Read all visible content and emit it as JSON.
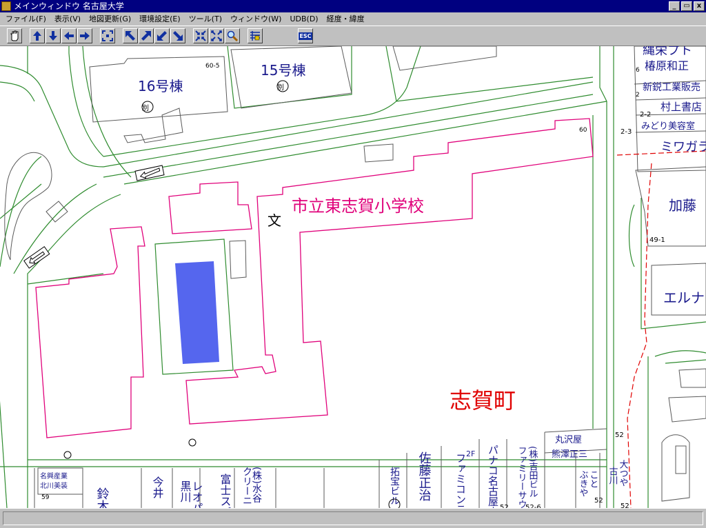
{
  "window": {
    "title": "メインウィンドウ 名古屋大学",
    "controls": [
      "_",
      "▭",
      "x"
    ]
  },
  "menu": [
    "ファイル(F)",
    "表示(V)",
    "地図更新(G)",
    "環境設定(E)",
    "ツール(T)",
    "ウィンドウ(W)",
    "UDB(D)",
    "経度・緯度"
  ],
  "toolbar": {
    "buttons": [
      {
        "name": "hand-tool",
        "icon": "hand-icon"
      },
      {
        "name": "pan-up",
        "icon": "arrow-up-icon"
      },
      {
        "name": "pan-down",
        "icon": "arrow-down-icon"
      },
      {
        "name": "pan-left",
        "icon": "arrow-left-icon"
      },
      {
        "name": "pan-right",
        "icon": "arrow-right-icon"
      },
      {
        "name": "center",
        "icon": "center-icon"
      },
      {
        "name": "pan-up-left",
        "icon": "arrow-up-left-icon"
      },
      {
        "name": "pan-up-right",
        "icon": "arrow-up-right-icon"
      },
      {
        "name": "pan-down-left",
        "icon": "arrow-down-left-icon"
      },
      {
        "name": "pan-down-right",
        "icon": "arrow-down-right-icon"
      },
      {
        "name": "zoom-out",
        "icon": "zoom-out-icon"
      },
      {
        "name": "zoom-in",
        "icon": "zoom-in-icon"
      },
      {
        "name": "search",
        "icon": "magnifier-icon"
      },
      {
        "name": "layers",
        "icon": "layers-icon"
      },
      {
        "name": "escape",
        "icon": "esc-icon",
        "label": "ESC"
      }
    ]
  },
  "map": {
    "colors": {
      "road": "#2e8b2e",
      "school": "#e0007a",
      "district": "#e00000",
      "pool": "#5566ee",
      "text": "#1a1a8c",
      "label": "#000000"
    },
    "labels": {
      "building16": "16号棟",
      "building15": "15号棟",
      "betsu": "別",
      "num_60_5": "60-5",
      "school_name": "市立東志賀小学校",
      "bun": "文",
      "num_60": "60",
      "district": "志賀町",
      "shop_1": "縄栄プト",
      "shop_2": "椿原和正",
      "num_6": "6",
      "num_2_1": "2",
      "shop_3": "新鋭工業販売",
      "num_2_2": "2-2",
      "shop_4": "村上書店",
      "shop_5": "みどり美容室",
      "num_2_3": "2-3",
      "shop_6": "ミワガラ",
      "shop_7": "加藤",
      "num_49_1": "49-1",
      "shop_8": "エルナ",
      "b1": "名興産業",
      "b2": "北川美装",
      "num_59": "59",
      "b3": "鈴木",
      "b4": "今井",
      "b5": "黒川",
      "b6": "レオパ",
      "b7": "富士スプリング",
      "b8": "(株)水谷",
      "b9": "クリーニ",
      "b10": "拓宝ビル",
      "b11": "佐藤正治",
      "b12": "ファミコンランド",
      "b13": "パナコ名古屋本店",
      "b14": "(株)吉田ビル",
      "b15": "ファミリーサウンド",
      "b16": "丸沢屋",
      "b17": "熊澤正三",
      "num_52a": "52",
      "b18": "こと",
      "b19": "ぶきや",
      "b20": "大つや",
      "b21": "古川",
      "num_52b": "52",
      "num_52c": "52",
      "num_52_6": "52-6",
      "num_52d": "52",
      "num_2f": "2F"
    }
  }
}
